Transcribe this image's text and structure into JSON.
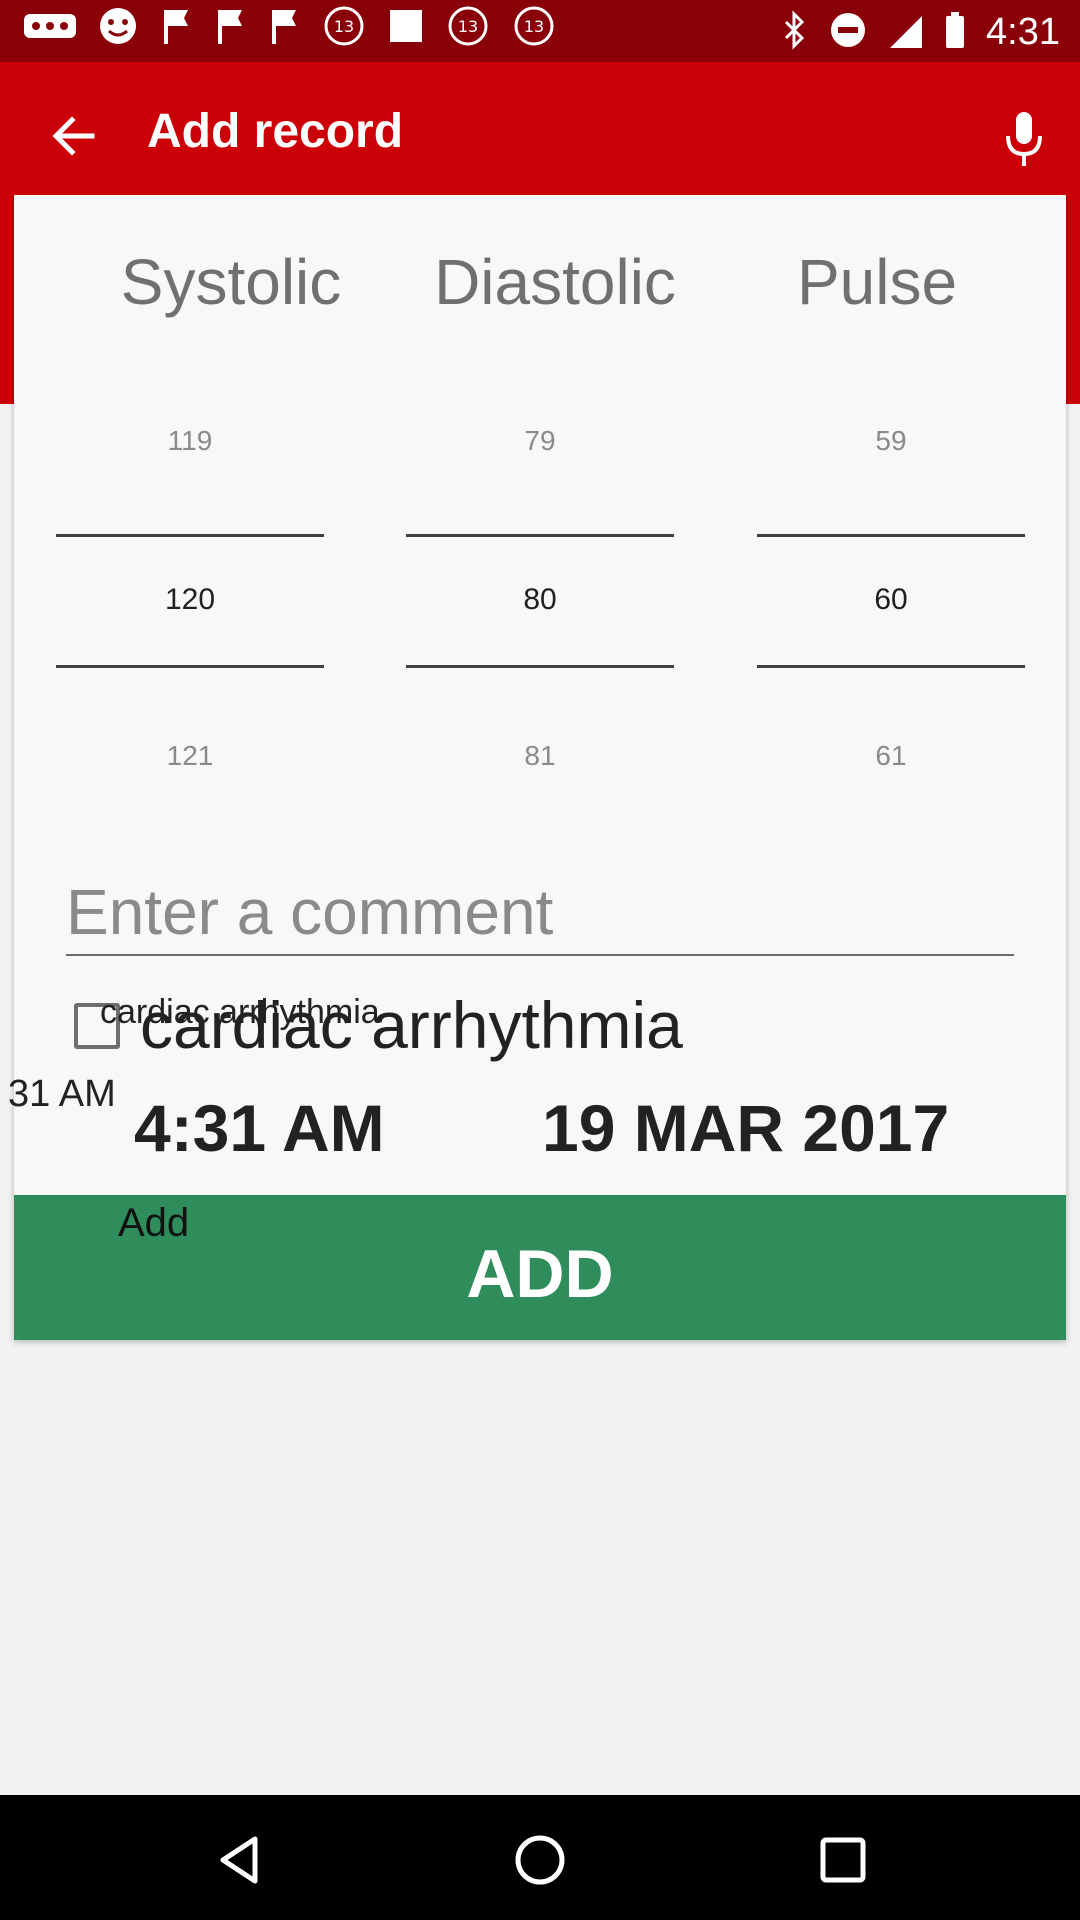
{
  "status_bar": {
    "time": "4:31",
    "icons": [
      "more-dots-icon",
      "face-icon",
      "flag-icon",
      "flag-icon",
      "flag-icon",
      "abc13-icon",
      "stop-icon",
      "abc13-icon",
      "abc13-icon",
      "bluetooth-icon",
      "do-not-disturb-icon",
      "cell-signal-icon",
      "battery-icon"
    ]
  },
  "app_bar": {
    "title": "Add record",
    "back_icon": "arrow-back-icon",
    "mic_icon": "microphone-icon"
  },
  "pickers": {
    "headers": [
      "Systolic",
      "Diastolic",
      "Pulse"
    ],
    "systolic": {
      "prev": "119",
      "value": "120",
      "next": "121"
    },
    "diastolic": {
      "prev": "79",
      "value": "80",
      "next": "81"
    },
    "pulse": {
      "prev": "59",
      "value": "60",
      "next": "61"
    }
  },
  "comment": {
    "placeholder": "Enter a comment",
    "value": ""
  },
  "arrhythmia": {
    "label": "cardiac arrhythmia",
    "overlay_label": "cardiac arrhythmia",
    "checked": false
  },
  "datetime": {
    "overlay_time": "31 AM",
    "time": "4:31 AM",
    "date": "19 MAR 2017"
  },
  "add_button": {
    "label": "ADD",
    "overlay_label": "Add",
    "color": "#2e8d5a"
  },
  "colors": {
    "app_bar": "#cc0007",
    "status_bar": "#8a0008"
  },
  "nav_bar": {
    "icons": [
      "back-triangle-icon",
      "home-circle-icon",
      "recents-square-icon"
    ]
  }
}
